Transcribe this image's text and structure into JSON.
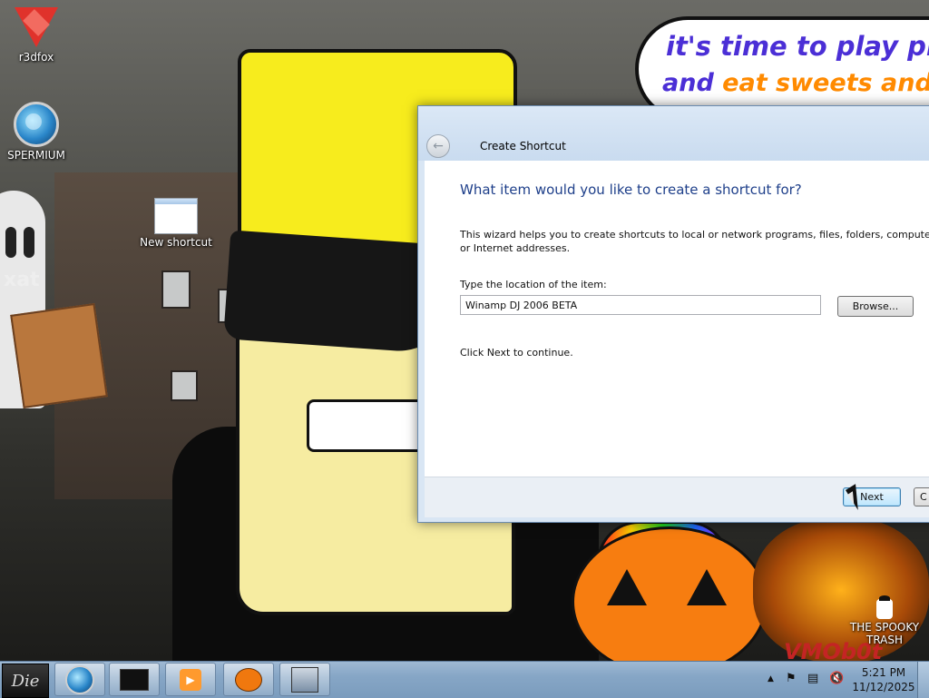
{
  "wallpaper": {
    "speech_line1": "it's time to play pra",
    "speech_line2_a": "and ",
    "speech_line2_b": "eat sweets and i",
    "watermark_left": "xat",
    "watermark_brand": "VMOb0t"
  },
  "desktop_icons": [
    {
      "label": "r3dfox",
      "icon": "r3dfox-icon"
    },
    {
      "label": "SPERMIUM",
      "icon": "browser-globe-icon"
    },
    {
      "label": "New shortcut",
      "icon": "shortcut-window-icon"
    },
    {
      "label": "THE SPOOKY TRASH",
      "icon": "trash-icon"
    }
  ],
  "dialog": {
    "title": "Create Shortcut",
    "heading": "What item would you like to create a shortcut for?",
    "description": "This wizard helps you to create shortcuts to local or network programs, files, folders, computers, or Internet addresses.",
    "location_label": "Type the location of the item:",
    "location_value": "Winamp DJ 2006 BETA",
    "browse_label": "Browse...",
    "continue_text": "Click Next to continue.",
    "next_label": "Next",
    "cancel_label": "C"
  },
  "taskbar": {
    "start_label": "Die",
    "pinned": [
      {
        "name": "browser",
        "icon": "browser-globe-icon"
      },
      {
        "name": "explorer",
        "icon": "folder-icon"
      },
      {
        "name": "media",
        "icon": "media-player-icon"
      },
      {
        "name": "pumpkin-app",
        "icon": "pumpkin-icon"
      },
      {
        "name": "setup",
        "icon": "setup-computer-icon"
      }
    ],
    "tray_icons": [
      "show-hidden-icons-icon",
      "action-center-flag-icon",
      "network-icon",
      "volume-muted-icon"
    ],
    "time": "5:21 PM",
    "date": "11/12/2025"
  },
  "colors": {
    "heading_blue": "#1e3f8a",
    "taskbar": "#86a6c6",
    "hat_yellow": "#f7ec1d",
    "pumpkin_orange": "#f77d10"
  }
}
